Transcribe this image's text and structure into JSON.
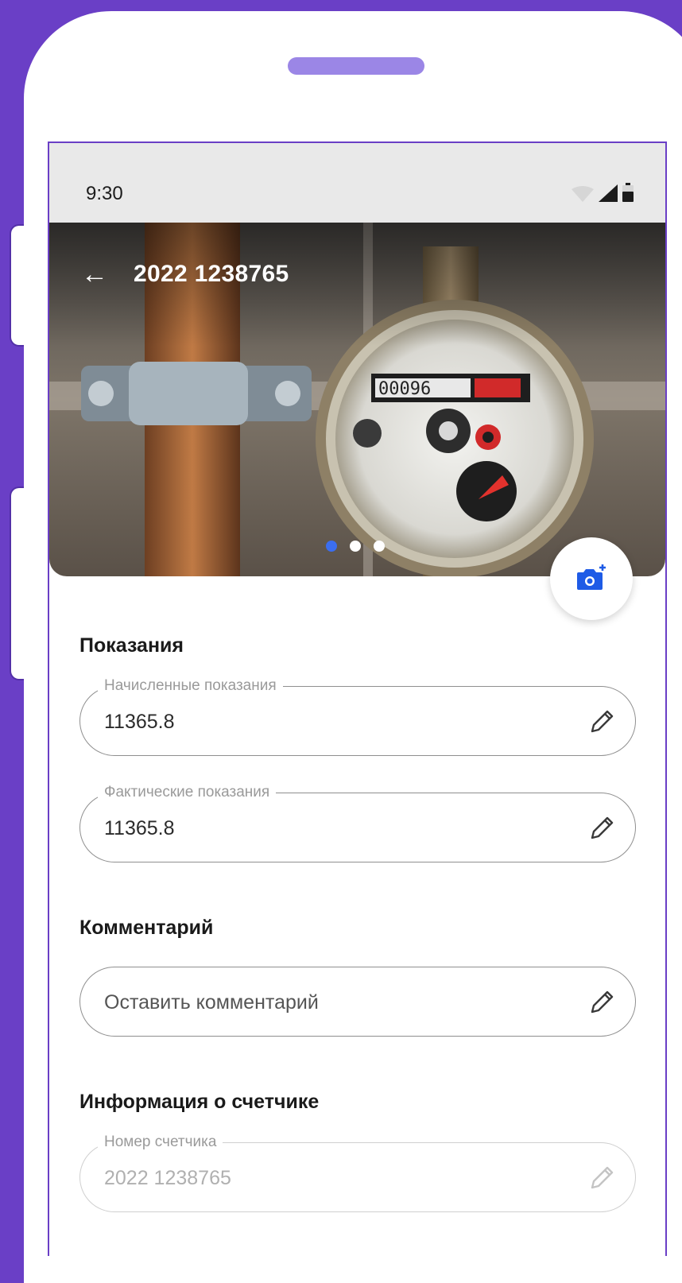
{
  "status": {
    "time": "9:30"
  },
  "appbar": {
    "title": "2022 1238765"
  },
  "gallery": {
    "dots": 3,
    "active_index": 0
  },
  "sections": {
    "readings_title": "Показания",
    "comment_title": "Комментарий",
    "info_title": "Информация о счетчике"
  },
  "fields": {
    "accrued": {
      "label": "Начисленные показания",
      "value": "11365.8"
    },
    "actual": {
      "label": "Фактические показания",
      "value": "11365.8"
    },
    "comment": {
      "placeholder": "Оставить комментарий"
    },
    "meter_number": {
      "label": "Номер счетчика",
      "value": "2022 1238765"
    }
  },
  "colors": {
    "background": "#6a3fc6",
    "notch": "#9b86e6",
    "dot_active": "#3b6ef0",
    "icon_accent": "#1e5be6"
  }
}
